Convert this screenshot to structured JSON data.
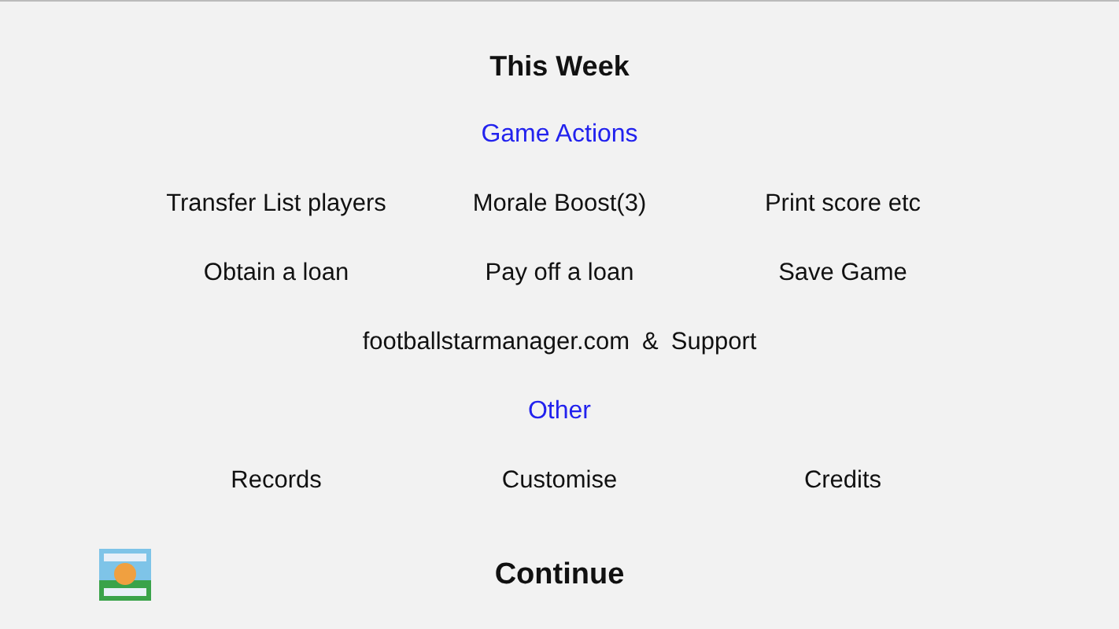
{
  "title": "This Week",
  "sections": [
    {
      "heading": "Game Actions",
      "rows": [
        [
          "Transfer List players",
          "Morale Boost(3)",
          "Print score etc"
        ],
        [
          "Obtain a loan",
          "Pay off a loan",
          "Save Game"
        ]
      ],
      "link_row": [
        "footballstarmanager.com",
        "&",
        "Support"
      ]
    },
    {
      "heading": "Other",
      "rows": [
        [
          "Records",
          "Customise",
          "Credits"
        ]
      ]
    }
  ],
  "continue_button": "Continue"
}
